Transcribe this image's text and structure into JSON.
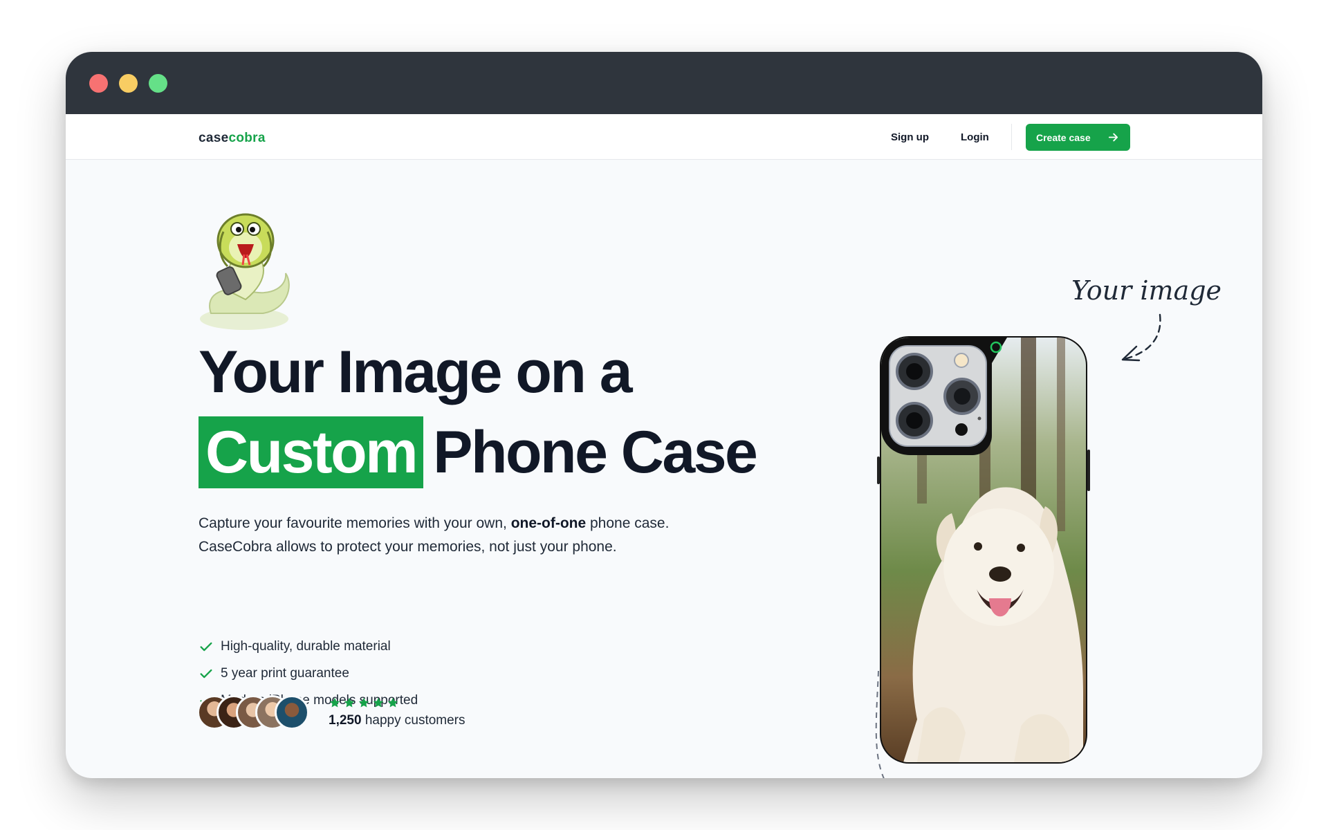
{
  "window": {
    "controls": [
      "close",
      "minimize",
      "maximize"
    ]
  },
  "nav": {
    "logo_main": "case",
    "logo_accent": "cobra",
    "signup": "Sign up",
    "login": "Login",
    "cta": "Create case"
  },
  "hero": {
    "headline_line1": "Your Image on a",
    "headline_highlight": "Custom",
    "headline_line2_rest": "Phone Case",
    "description_part1": "Capture your favourite memories with your own, ",
    "description_bold": "one-of-one",
    "description_part2": " phone case. CaseCobra allows to protect your memories, not just your phone.",
    "features": [
      "High-quality, durable material",
      "5 year print guarantee",
      "Modern iPhone models supported"
    ],
    "rating_stars": 5,
    "customers_count": "1,250",
    "customers_label": " happy customers"
  },
  "showcase": {
    "handwritten_label": "Your image",
    "icons": [
      "arrow-doodle-icon",
      "dog-photo",
      "phone-case"
    ]
  },
  "colors": {
    "brand_green": "#16a34a",
    "titlebar": "#2f353d",
    "text_dark": "#111827",
    "page_bg": "#f8fafc"
  }
}
